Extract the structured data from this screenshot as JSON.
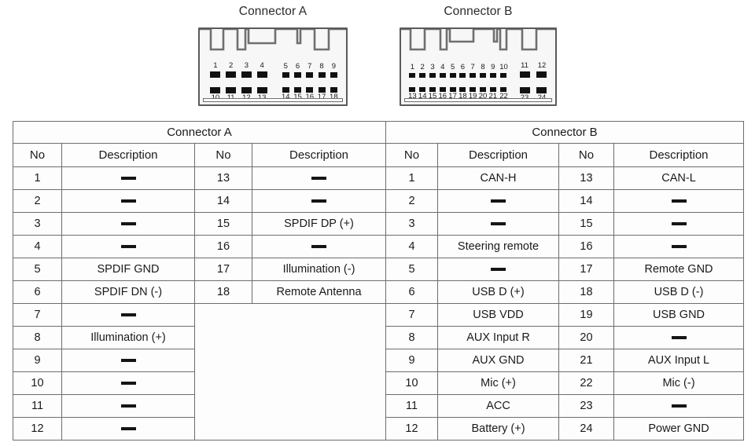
{
  "diagrams": {
    "connector_a": {
      "caption": "Connector A",
      "top_row_group1": [
        "1",
        "2",
        "3",
        "4"
      ],
      "top_row_group2": [
        "5",
        "6",
        "7",
        "8",
        "9"
      ],
      "bottom_row_group1": [
        "10",
        "11",
        "12",
        "13"
      ],
      "bottom_row_group2": [
        "14",
        "15",
        "16",
        "17",
        "18"
      ]
    },
    "connector_b": {
      "caption": "Connector B",
      "top_row_group1": [
        "1",
        "2",
        "3",
        "4",
        "5",
        "6",
        "7",
        "8",
        "9",
        "10"
      ],
      "top_row_group2": [
        "11",
        "12"
      ],
      "bottom_row_group1": [
        "13",
        "14",
        "15",
        "16",
        "17",
        "18",
        "19",
        "20",
        "21",
        "22"
      ],
      "bottom_row_group2": [
        "23",
        "24"
      ]
    }
  },
  "table": {
    "group_headers": [
      "Connector A",
      "Connector B"
    ],
    "column_headers": [
      "No",
      "Description",
      "No",
      "Description"
    ],
    "dash_symbol": "—",
    "connector_a": {
      "left": [
        {
          "no": "1",
          "description": "—"
        },
        {
          "no": "2",
          "description": "—"
        },
        {
          "no": "3",
          "description": "—"
        },
        {
          "no": "4",
          "description": "—"
        },
        {
          "no": "5",
          "description": "SPDIF GND"
        },
        {
          "no": "6",
          "description": "SPDIF DN (-)"
        },
        {
          "no": "7",
          "description": "—"
        },
        {
          "no": "8",
          "description": "Illumination (+)"
        },
        {
          "no": "9",
          "description": "—"
        },
        {
          "no": "10",
          "description": "—"
        },
        {
          "no": "11",
          "description": "—"
        },
        {
          "no": "12",
          "description": "—"
        }
      ],
      "right": [
        {
          "no": "13",
          "description": "—"
        },
        {
          "no": "14",
          "description": "—"
        },
        {
          "no": "15",
          "description": "SPDIF DP (+)"
        },
        {
          "no": "16",
          "description": "—"
        },
        {
          "no": "17",
          "description": "Illumination (-)"
        },
        {
          "no": "18",
          "description": "Remote Antenna"
        }
      ]
    },
    "connector_b": {
      "left": [
        {
          "no": "1",
          "description": "CAN-H"
        },
        {
          "no": "2",
          "description": "—"
        },
        {
          "no": "3",
          "description": "—"
        },
        {
          "no": "4",
          "description": "Steering remote"
        },
        {
          "no": "5",
          "description": "—"
        },
        {
          "no": "6",
          "description": "USB D (+)"
        },
        {
          "no": "7",
          "description": "USB VDD"
        },
        {
          "no": "8",
          "description": "AUX Input R"
        },
        {
          "no": "9",
          "description": "AUX GND"
        },
        {
          "no": "10",
          "description": "Mic (+)"
        },
        {
          "no": "11",
          "description": "ACC"
        },
        {
          "no": "12",
          "description": "Battery (+)"
        }
      ],
      "right": [
        {
          "no": "13",
          "description": "CAN-L"
        },
        {
          "no": "14",
          "description": "—"
        },
        {
          "no": "15",
          "description": "—"
        },
        {
          "no": "16",
          "description": "—"
        },
        {
          "no": "17",
          "description": "Remote GND"
        },
        {
          "no": "18",
          "description": "USB D (-)"
        },
        {
          "no": "19",
          "description": "USB GND"
        },
        {
          "no": "20",
          "description": "—"
        },
        {
          "no": "21",
          "description": "AUX Input L"
        },
        {
          "no": "22",
          "description": "Mic (-)"
        },
        {
          "no": "23",
          "description": "—"
        },
        {
          "no": "24",
          "description": "Power GND"
        }
      ]
    }
  },
  "colors": {
    "border": "#6d6d6d",
    "pin": "#111111",
    "housing_fill": "#f7f7f7",
    "housing_stroke": "#5a5a5a",
    "text": "#1a1a1a"
  }
}
